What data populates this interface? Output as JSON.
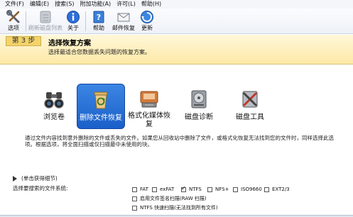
{
  "menu": [
    "文件(F)",
    "编辑(E)",
    "搜索(S)",
    "附加功能(A)",
    "许可(L)",
    "帮助(H)"
  ],
  "toolbar": {
    "options": "选项",
    "refresh_list": "刷新磁盘列表",
    "about": "关于",
    "help": "帮助",
    "mail_recovery": "邮件恢复",
    "update": "更新"
  },
  "step": {
    "badge": "第 3 步",
    "title": "选择恢复方案",
    "description": "选择最适合您数据丢失问题的恢复方案。"
  },
  "options": [
    {
      "label": "浏览卷",
      "icon": "binoculars-icon"
    },
    {
      "label": "删除文件恢复",
      "icon": "recycle-bin-icon",
      "selected": true
    },
    {
      "label": "格式化媒体恢复",
      "icon": "format-disk-icon"
    },
    {
      "label": "磁盘诊断",
      "icon": "disk-diagnostics-icon"
    },
    {
      "label": "磁盘工具",
      "icon": "disk-tools-icon"
    }
  ],
  "description": "通过文件内容找到意外删除的文件或丢失的文件。如果您从回收站中删除了文件，或格式化恢复无法找到您的文件时，同样选择此选项。根据选项，将全面扫描或仅扫描最中未使用的块。",
  "details_toggle": "(单击获得细节)",
  "filesystem_label": "选择要搜索的文件系统:",
  "filesystems": [
    {
      "label": "FAT",
      "checked": false
    },
    {
      "label": "exFAT",
      "checked": false
    },
    {
      "label": "NTFS",
      "checked": true
    },
    {
      "label": "NFS+",
      "checked": false
    },
    {
      "label": "ISO9660",
      "checked": false
    },
    {
      "label": "EXT2/3",
      "checked": false
    }
  ],
  "extra_options": [
    {
      "label": "启用文件签名扫描(RAW 扫描)",
      "checked": false
    },
    {
      "label": "NTFS 快速扫描(无法找到所有文件)",
      "checked": false
    }
  ],
  "colors": {
    "selected_option": "#1f66d0",
    "step_panel": "#fdeeb5"
  }
}
